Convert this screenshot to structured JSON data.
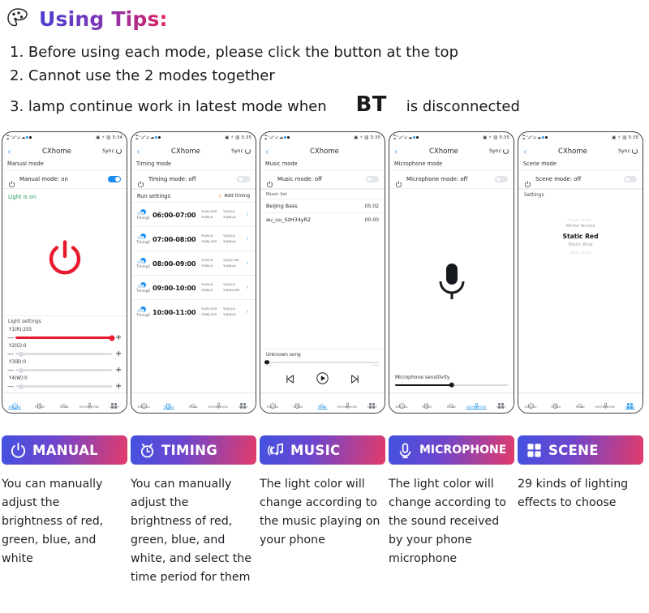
{
  "header": {
    "title": "Using Tips:",
    "palette_icon": "palette-icon",
    "tips": [
      "1. Before using each mode, please click the button at the top",
      "2. Cannot use the 2 modes together"
    ],
    "tip3_before": "3. lamp continue work in latest mode when",
    "tip3_bt": "BT",
    "tip3_after": "is disconnected"
  },
  "phones": [
    {
      "status": {
        "time": "5:34",
        "icons": "signal-wifi-bluetooth"
      },
      "nav": {
        "back": "back-icon",
        "title": "CXhome",
        "sync": "Sync"
      },
      "mode_label": "Manual mode",
      "toggle": {
        "label": "Manual mode: on",
        "state": "on"
      },
      "light_status": "Light is on",
      "light_settings_label": "Light settings",
      "sliders": [
        {
          "label": "Y1(R):255",
          "value": 255,
          "percent": 100,
          "color": "#e8192c"
        },
        {
          "label": "Y2(G):0",
          "value": 0,
          "percent": 0,
          "color": "#dcdfe3"
        },
        {
          "label": "Y3(B):0",
          "value": 0,
          "percent": 0,
          "color": "#dcdfe3"
        },
        {
          "label": "Y4(W):0",
          "value": 0,
          "percent": 0,
          "color": "#dcdfe3"
        }
      ],
      "active_tab": "MANUAL"
    },
    {
      "status": {
        "time": "5:35"
      },
      "nav": {
        "title": "CXhome",
        "sync": "Sync"
      },
      "mode_label": "Timing mode",
      "toggle": {
        "label": "Timing mode: off",
        "state": "off"
      },
      "run_settings_label": "Run settings",
      "add_timing_label": "Add timing",
      "timings": [
        {
          "name": "Timing1",
          "time": "06:00-07:00",
          "v1": "Y1(R):255",
          "v2": "Y2(G):0",
          "v3": "Y3(B):0",
          "v4": "Y4(W):0"
        },
        {
          "name": "Timing2",
          "time": "07:00-08:00",
          "v1": "Y1(R):0",
          "v2": "Y2(G):0",
          "v3": "Y3(B):255",
          "v4": "Y4(W):0"
        },
        {
          "name": "Timing3",
          "time": "08:00-09:00",
          "v1": "Y1(R):0",
          "v2": "Y2(G):255",
          "v3": "Y3(B):0",
          "v4": "Y4(W):0"
        },
        {
          "name": "Timing4",
          "time": "09:00-10:00",
          "v1": "Y1(R):0",
          "v2": "Y2(G):0",
          "v3": "Y3(B):0",
          "v4": "Y4(W):255"
        },
        {
          "name": "Timing5",
          "time": "10:00-11:00",
          "v1": "Y1(R):255",
          "v2": "Y2(G):0",
          "v3": "Y3(B):255",
          "v4": "Y4(W):0"
        }
      ],
      "active_tab": "TIMING"
    },
    {
      "status": {
        "time": "5:35"
      },
      "nav": {
        "title": "CXhome"
      },
      "mode_label": "Music mode",
      "toggle": {
        "label": "Music mode: off",
        "state": "off"
      },
      "music_list_label": "Music list",
      "songs": [
        {
          "name": "Beijing Bass",
          "duration": "05:02"
        },
        {
          "name": "au_uu_SzH34yR2",
          "duration": "00:00"
        }
      ],
      "player": {
        "title": "Unknown song",
        "elapsed": "--:--",
        "remaining": "--:--",
        "prev_icon": "previous-track-icon",
        "play_icon": "play-icon",
        "next_icon": "next-track-icon"
      },
      "active_tab": "MUSIC"
    },
    {
      "status": {
        "time": "5:35"
      },
      "nav": {
        "title": "CXhome",
        "sync": "Sync"
      },
      "mode_label": "Microphone mode",
      "toggle": {
        "label": "Microphone mode: off",
        "state": "off"
      },
      "mic_icon": "microphone-icon",
      "sensitivity_label": "Microphone sensitivity",
      "sensitivity_percent": 50,
      "active_tab": "MICROPHONE"
    },
    {
      "status": {
        "time": "5:35"
      },
      "nav": {
        "title": "CXhome",
        "sync": "Sync"
      },
      "mode_label": "Scene mode",
      "toggle": {
        "label": "Scene mode: off",
        "state": "off"
      },
      "settings_label": "Settings",
      "scenes": [
        "Purple Strobe",
        "White Strobe",
        "Static Red",
        "Static Blue",
        "Static Green"
      ],
      "selected_scene": "Static Red",
      "active_tab": "SCENE"
    }
  ],
  "tabs": [
    {
      "label": "MANUAL",
      "icon": "power-icon"
    },
    {
      "label": "TIMING",
      "icon": "alarm-clock-icon"
    },
    {
      "label": "MUSIC",
      "icon": "music-note-icon"
    },
    {
      "label": "MICROPHONE",
      "icon": "microphone-icon"
    },
    {
      "label": "SCENE",
      "icon": "grid-icon"
    }
  ],
  "banners": [
    {
      "label": "MANUAL",
      "icon": "power-icon"
    },
    {
      "label": "TIMING",
      "icon": "alarm-clock-icon"
    },
    {
      "label": "MUSIC",
      "icon": "music-note-icon"
    },
    {
      "label": "MICROPHONE",
      "icon": "microphone-icon"
    },
    {
      "label": "SCENE",
      "icon": "grid-icon"
    }
  ],
  "descriptions": [
    "You can manually adjust the brightness of red, green, blue, and white",
    "You can manually adjust the brightness of red, green, blue, and white, and select the time period for them",
    "The light color will change according to the music playing on your phone",
    "The light color will change according to the sound received by your phone  microphone",
    "29 kinds of lighting effects to choose"
  ],
  "colors": {
    "gradient_start": "#4352e0",
    "gradient_end": "#e23b6b",
    "accent_blue": "#1a8df0",
    "red": "#e8192c",
    "green_text": "#1e9b57"
  }
}
